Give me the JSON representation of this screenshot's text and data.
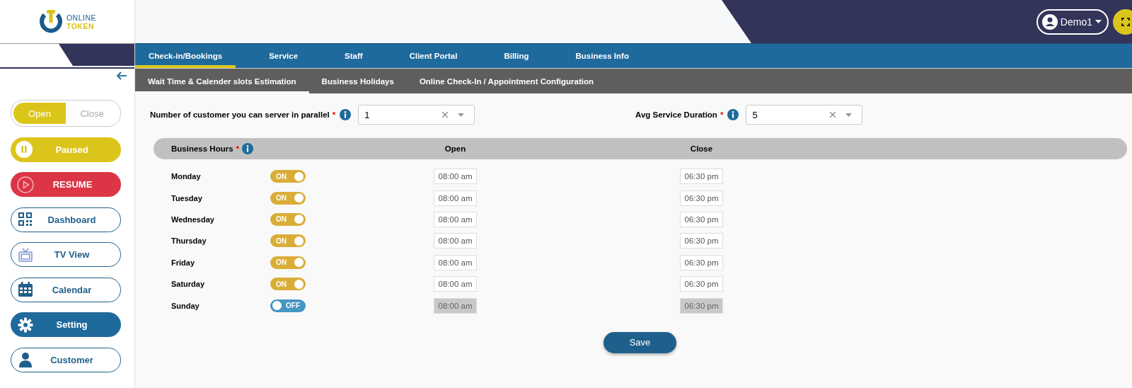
{
  "brand": {
    "line1": "ONLINE",
    "line2": "TOKEN"
  },
  "sidebar": {
    "items": [
      {
        "kind": "segmented",
        "options": [
          {
            "label": "Open",
            "selected": true
          },
          {
            "label": "Close",
            "selected": false
          }
        ]
      },
      {
        "kind": "paused",
        "label": "Paused"
      },
      {
        "kind": "resume",
        "label": "RESUME"
      },
      {
        "kind": "nav",
        "label": "Dashboard",
        "selected": false
      },
      {
        "kind": "nav",
        "label": "TV View",
        "selected": false
      },
      {
        "kind": "nav",
        "label": "Calendar",
        "selected": false
      },
      {
        "kind": "nav",
        "label": "Setting",
        "selected": true
      },
      {
        "kind": "nav",
        "label": "Customer",
        "selected": false
      }
    ]
  },
  "user": {
    "name": "Demo1"
  },
  "tabs": [
    {
      "label": "Check-in/Bookings",
      "selected": true
    },
    {
      "label": "Service",
      "selected": false
    },
    {
      "label": "Staff",
      "selected": false
    },
    {
      "label": "Client Portal",
      "selected": false
    },
    {
      "label": "Billing",
      "selected": false
    },
    {
      "label": "Business Info",
      "selected": false
    }
  ],
  "subtabs": [
    {
      "label": "Wait Time & Calender slots Estimation",
      "selected": true
    },
    {
      "label": "Business Holidays",
      "selected": false
    },
    {
      "label": "Online Check-In / Appointment Configuration",
      "selected": false
    }
  ],
  "fields": [
    {
      "label": "Number of customer you can server in parallel",
      "required_mark": "*",
      "value": "1"
    },
    {
      "label": "Avg Service Duration",
      "required_mark": "*",
      "value": "5"
    }
  ],
  "hours": {
    "title": "Business Hours",
    "required_mark": "*",
    "open_heading": "Open",
    "close_heading": "Close",
    "days": [
      {
        "name": "Monday",
        "on": true,
        "switch_text": "ON",
        "open": "08:00 am",
        "close": "06:30 pm"
      },
      {
        "name": "Tuesday",
        "on": true,
        "switch_text": "ON",
        "open": "08:00 am",
        "close": "06:30 pm"
      },
      {
        "name": "Wednesday",
        "on": true,
        "switch_text": "ON",
        "open": "08:00 am",
        "close": "06:30 pm"
      },
      {
        "name": "Thursday",
        "on": true,
        "switch_text": "ON",
        "open": "08:00 am",
        "close": "06:30 pm"
      },
      {
        "name": "Friday",
        "on": true,
        "switch_text": "ON",
        "open": "08:00 am",
        "close": "06:30 pm"
      },
      {
        "name": "Saturday",
        "on": true,
        "switch_text": "ON",
        "open": "08:00 am",
        "close": "06:30 pm"
      },
      {
        "name": "Sunday",
        "on": false,
        "switch_text": "OFF",
        "open": "08:00 am",
        "close": "06:30 pm"
      }
    ]
  },
  "save_button": "Save"
}
